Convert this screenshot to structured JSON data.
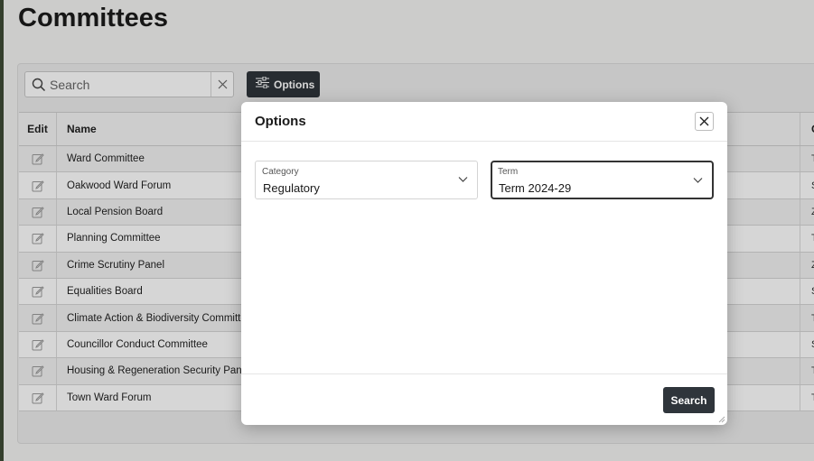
{
  "page": {
    "title": "Committees"
  },
  "toolbar": {
    "search_placeholder": "Search",
    "options_label": "Options"
  },
  "table": {
    "columns": {
      "edit": "Edit",
      "name": "Name",
      "more": "C"
    },
    "rows": [
      {
        "name": "Ward Committee",
        "more": "T"
      },
      {
        "name": "Oakwood Ward Forum",
        "more": "S"
      },
      {
        "name": "Local Pension Board",
        "more": "Z"
      },
      {
        "name": "Planning Committee",
        "more": "T"
      },
      {
        "name": "Crime Scrutiny Panel",
        "more": "Z"
      },
      {
        "name": "Equalities Board",
        "more": "S"
      },
      {
        "name": "Climate Action & Biodiversity Committee",
        "more": "T"
      },
      {
        "name": "Councillor Conduct Committee",
        "more": "S"
      },
      {
        "name": "Housing & Regeneration Security Panel",
        "more": "T"
      },
      {
        "name": "Town Ward Forum",
        "more": "T"
      }
    ]
  },
  "dialog": {
    "title": "Options",
    "category": {
      "label": "Category",
      "value": "Regulatory"
    },
    "term": {
      "label": "Term",
      "value": "Term 2024-29"
    },
    "search_label": "Search"
  },
  "icons": {
    "search": "search-icon",
    "clear": "close-icon",
    "options": "sliders-icon",
    "edit": "edit-icon",
    "close": "close-icon",
    "chevron": "chevron-down-icon"
  },
  "colors": {
    "dark_button": "#2f353b",
    "row_alt": "#f2f2f2"
  }
}
